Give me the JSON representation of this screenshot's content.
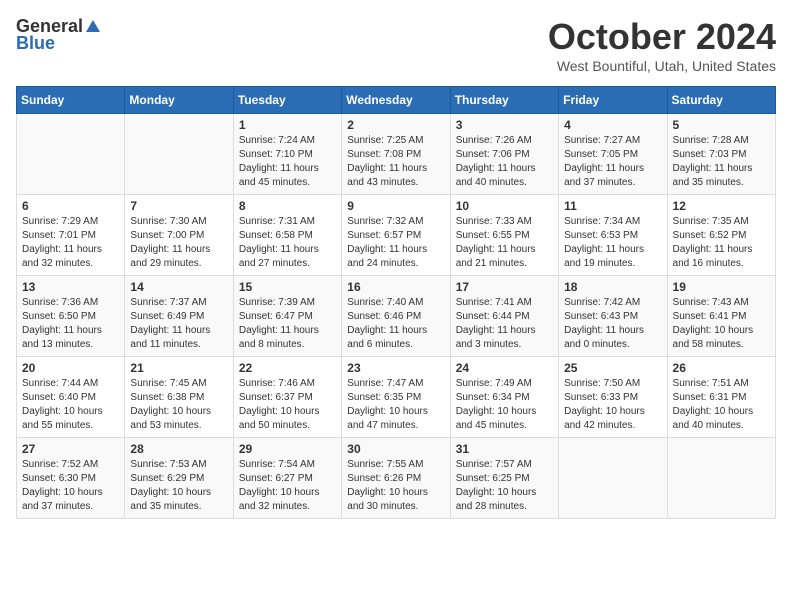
{
  "header": {
    "logo_general": "General",
    "logo_blue": "Blue",
    "title": "October 2024",
    "location": "West Bountiful, Utah, United States"
  },
  "days_of_week": [
    "Sunday",
    "Monday",
    "Tuesday",
    "Wednesday",
    "Thursday",
    "Friday",
    "Saturday"
  ],
  "weeks": [
    [
      {
        "day": "",
        "text": ""
      },
      {
        "day": "",
        "text": ""
      },
      {
        "day": "1",
        "text": "Sunrise: 7:24 AM\nSunset: 7:10 PM\nDaylight: 11 hours and 45 minutes."
      },
      {
        "day": "2",
        "text": "Sunrise: 7:25 AM\nSunset: 7:08 PM\nDaylight: 11 hours and 43 minutes."
      },
      {
        "day": "3",
        "text": "Sunrise: 7:26 AM\nSunset: 7:06 PM\nDaylight: 11 hours and 40 minutes."
      },
      {
        "day": "4",
        "text": "Sunrise: 7:27 AM\nSunset: 7:05 PM\nDaylight: 11 hours and 37 minutes."
      },
      {
        "day": "5",
        "text": "Sunrise: 7:28 AM\nSunset: 7:03 PM\nDaylight: 11 hours and 35 minutes."
      }
    ],
    [
      {
        "day": "6",
        "text": "Sunrise: 7:29 AM\nSunset: 7:01 PM\nDaylight: 11 hours and 32 minutes."
      },
      {
        "day": "7",
        "text": "Sunrise: 7:30 AM\nSunset: 7:00 PM\nDaylight: 11 hours and 29 minutes."
      },
      {
        "day": "8",
        "text": "Sunrise: 7:31 AM\nSunset: 6:58 PM\nDaylight: 11 hours and 27 minutes."
      },
      {
        "day": "9",
        "text": "Sunrise: 7:32 AM\nSunset: 6:57 PM\nDaylight: 11 hours and 24 minutes."
      },
      {
        "day": "10",
        "text": "Sunrise: 7:33 AM\nSunset: 6:55 PM\nDaylight: 11 hours and 21 minutes."
      },
      {
        "day": "11",
        "text": "Sunrise: 7:34 AM\nSunset: 6:53 PM\nDaylight: 11 hours and 19 minutes."
      },
      {
        "day": "12",
        "text": "Sunrise: 7:35 AM\nSunset: 6:52 PM\nDaylight: 11 hours and 16 minutes."
      }
    ],
    [
      {
        "day": "13",
        "text": "Sunrise: 7:36 AM\nSunset: 6:50 PM\nDaylight: 11 hours and 13 minutes."
      },
      {
        "day": "14",
        "text": "Sunrise: 7:37 AM\nSunset: 6:49 PM\nDaylight: 11 hours and 11 minutes."
      },
      {
        "day": "15",
        "text": "Sunrise: 7:39 AM\nSunset: 6:47 PM\nDaylight: 11 hours and 8 minutes."
      },
      {
        "day": "16",
        "text": "Sunrise: 7:40 AM\nSunset: 6:46 PM\nDaylight: 11 hours and 6 minutes."
      },
      {
        "day": "17",
        "text": "Sunrise: 7:41 AM\nSunset: 6:44 PM\nDaylight: 11 hours and 3 minutes."
      },
      {
        "day": "18",
        "text": "Sunrise: 7:42 AM\nSunset: 6:43 PM\nDaylight: 11 hours and 0 minutes."
      },
      {
        "day": "19",
        "text": "Sunrise: 7:43 AM\nSunset: 6:41 PM\nDaylight: 10 hours and 58 minutes."
      }
    ],
    [
      {
        "day": "20",
        "text": "Sunrise: 7:44 AM\nSunset: 6:40 PM\nDaylight: 10 hours and 55 minutes."
      },
      {
        "day": "21",
        "text": "Sunrise: 7:45 AM\nSunset: 6:38 PM\nDaylight: 10 hours and 53 minutes."
      },
      {
        "day": "22",
        "text": "Sunrise: 7:46 AM\nSunset: 6:37 PM\nDaylight: 10 hours and 50 minutes."
      },
      {
        "day": "23",
        "text": "Sunrise: 7:47 AM\nSunset: 6:35 PM\nDaylight: 10 hours and 47 minutes."
      },
      {
        "day": "24",
        "text": "Sunrise: 7:49 AM\nSunset: 6:34 PM\nDaylight: 10 hours and 45 minutes."
      },
      {
        "day": "25",
        "text": "Sunrise: 7:50 AM\nSunset: 6:33 PM\nDaylight: 10 hours and 42 minutes."
      },
      {
        "day": "26",
        "text": "Sunrise: 7:51 AM\nSunset: 6:31 PM\nDaylight: 10 hours and 40 minutes."
      }
    ],
    [
      {
        "day": "27",
        "text": "Sunrise: 7:52 AM\nSunset: 6:30 PM\nDaylight: 10 hours and 37 minutes."
      },
      {
        "day": "28",
        "text": "Sunrise: 7:53 AM\nSunset: 6:29 PM\nDaylight: 10 hours and 35 minutes."
      },
      {
        "day": "29",
        "text": "Sunrise: 7:54 AM\nSunset: 6:27 PM\nDaylight: 10 hours and 32 minutes."
      },
      {
        "day": "30",
        "text": "Sunrise: 7:55 AM\nSunset: 6:26 PM\nDaylight: 10 hours and 30 minutes."
      },
      {
        "day": "31",
        "text": "Sunrise: 7:57 AM\nSunset: 6:25 PM\nDaylight: 10 hours and 28 minutes."
      },
      {
        "day": "",
        "text": ""
      },
      {
        "day": "",
        "text": ""
      }
    ]
  ]
}
